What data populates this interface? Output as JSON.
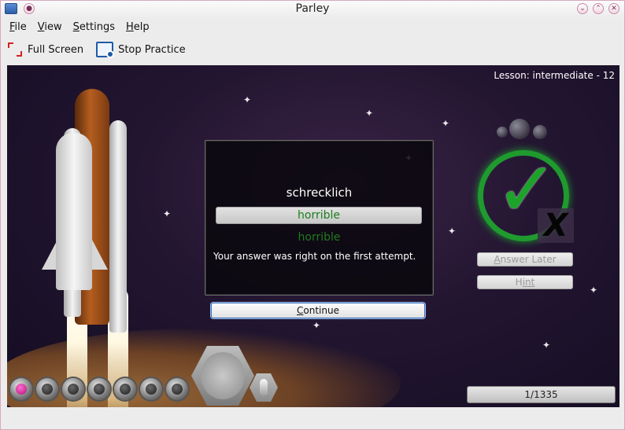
{
  "window": {
    "title": "Parley"
  },
  "menu": [
    {
      "label": "File",
      "key": "F",
      "rest": "ile"
    },
    {
      "label": "View",
      "key": "V",
      "rest": "iew"
    },
    {
      "label": "Settings",
      "key": "S",
      "rest": "ettings"
    },
    {
      "label": "Help",
      "key": "H",
      "rest": "elp"
    }
  ],
  "toolbar": {
    "fullscreen_label": "Full Screen",
    "fullscreen_icon": "fullscreen-icon",
    "stop_label": "Stop Practice",
    "stop_icon": "stop-practice-icon"
  },
  "lesson": "Lesson: intermediate - 12",
  "card": {
    "question": "schrecklich",
    "user_answer": "horrible",
    "correct_answer": "horrible",
    "feedback": "Your answer was right on the first attempt."
  },
  "continue_button": {
    "key": "C",
    "rest": "ontinue"
  },
  "side": {
    "answer_later": {
      "key": "A",
      "rest": "nswer Later"
    },
    "hint": {
      "key": "H",
      "rest": "int"
    },
    "result_icon": "checkmark-icon",
    "wrong_icon": "cross-icon"
  },
  "progress_text": "1/1335",
  "colors": {
    "correct": "#1f7a1f",
    "check": "#1ba32a",
    "accent": "#3c6fb8"
  }
}
